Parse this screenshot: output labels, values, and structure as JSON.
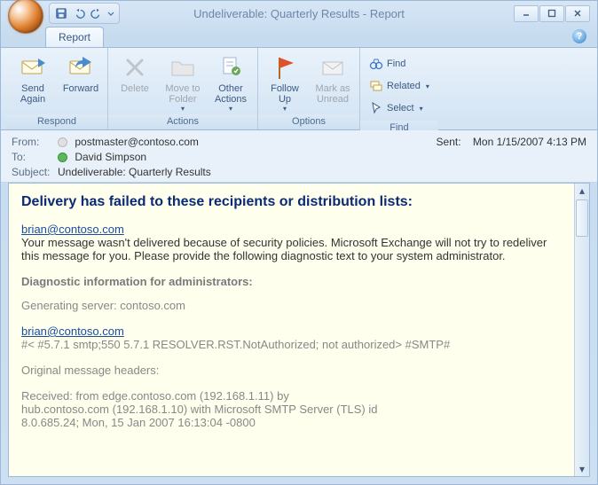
{
  "window": {
    "title": "Undeliverable: Quarterly Results - Report"
  },
  "tabs": {
    "report": "Report"
  },
  "ribbon": {
    "respond": {
      "label": "Respond",
      "send_again": "Send\nAgain",
      "forward": "Forward"
    },
    "actions": {
      "label": "Actions",
      "delete": "Delete",
      "move_to_folder": "Move to\nFolder",
      "other_actions": "Other\nActions"
    },
    "options": {
      "label": "Options",
      "follow_up": "Follow\nUp",
      "mark_unread": "Mark as\nUnread"
    },
    "find": {
      "label": "Find",
      "find": "Find",
      "related": "Related",
      "select": "Select"
    }
  },
  "header": {
    "from_label": "From:",
    "from": "postmaster@contoso.com",
    "to_label": "To:",
    "to": "David Simpson",
    "subject_label": "Subject:",
    "subject": "Undeliverable: Quarterly Results",
    "sent_label": "Sent:",
    "sent": "Mon 1/15/2007 4:13 PM"
  },
  "ndr": {
    "title": "Delivery has failed to these recipients or distribution lists:",
    "recipient": "brian@contoso.com",
    "explain": "Your message wasn't delivered because of security policies. Microsoft Exchange will not try to redeliver this message for you. Please provide the following diagnostic text to your system administrator.",
    "diag_heading": "Diagnostic information for administrators:",
    "gen_server": "Generating server: contoso.com",
    "recipient2": "brian@contoso.com",
    "smtp_line": "#< #5.7.1 smtp;550 5.7.1 RESOLVER.RST.NotAuthorized; not authorized> #SMTP#",
    "orig_headers": "Original message headers:",
    "received1": "Received: from edge.contoso.com (192.168.1.11) by",
    "received2": " hub.contoso.com (192.168.1.10) with Microsoft SMTP Server (TLS) id",
    "received3": " 8.0.685.24; Mon, 15 Jan 2007 16:13:04 -0800"
  },
  "help": "?"
}
